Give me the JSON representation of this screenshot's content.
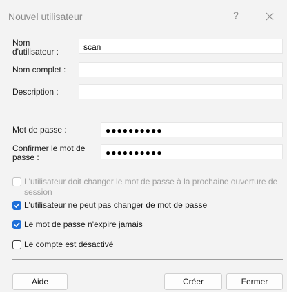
{
  "window": {
    "title": "Nouvel utilisateur",
    "help_glyph": "?"
  },
  "form": {
    "username": {
      "label": "Nom d'utilisateur :",
      "value": "scan"
    },
    "fullname": {
      "label": "Nom complet :",
      "value": ""
    },
    "description": {
      "label": "Description :",
      "value": ""
    },
    "password": {
      "label": "Mot de passe :",
      "value": "●●●●●●●●●●"
    },
    "confirm": {
      "label": "Confirmer le mot de passe :",
      "value": "●●●●●●●●●●"
    }
  },
  "options": [
    {
      "label": "L'utilisateur doit changer le mot de passe à la prochaine ouverture de session",
      "checked": false,
      "disabled": true
    },
    {
      "label": "L'utilisateur ne peut pas changer de mot de passe",
      "checked": true,
      "disabled": false
    },
    {
      "label": "Le mot de passe n'expire jamais",
      "checked": true,
      "disabled": false
    },
    {
      "label": "Le compte est désactivé",
      "checked": false,
      "disabled": false
    }
  ],
  "buttons": {
    "help": "Aide",
    "create": "Créer",
    "close": "Fermer"
  },
  "colors": {
    "accent": "#1e6fd9",
    "background": "#f3f3f3"
  },
  "icons": {
    "close": "close-icon",
    "check": "check-icon"
  }
}
